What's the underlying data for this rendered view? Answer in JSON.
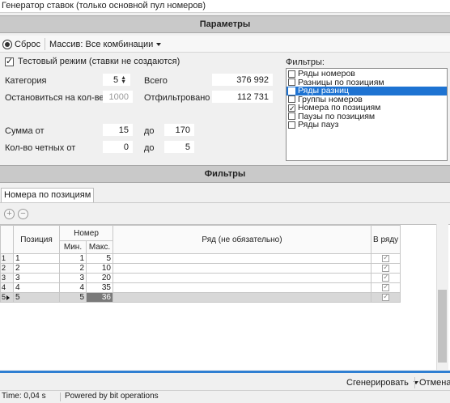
{
  "window": {
    "title": "Генератор ставок (только основной пул номеров)"
  },
  "params_header": "Параметры",
  "toolbar": {
    "reset_label": "Сброс",
    "massiv_label": "Массив: Все комбинации"
  },
  "test_mode": {
    "label": "Тестовый режим (ставки не создаются)",
    "checked": true
  },
  "fields": {
    "category_label": "Категория",
    "category_value": "5",
    "total_label": "Всего",
    "total_value": "376 992",
    "stop_label": "Остановиться на кол-ве",
    "stop_value": "1000",
    "filtered_label": "Отфильтровано",
    "filtered_value": "112 731",
    "sum_label": "Сумма от",
    "sum_from": "15",
    "sum_to_label": "до",
    "sum_to": "170",
    "even_label": "Кол-во четных от",
    "even_from": "0",
    "even_to_label": "до",
    "even_to": "5"
  },
  "filters": {
    "label": "Фильтры:",
    "items": [
      {
        "label": "Ряды номеров",
        "checked": false,
        "selected": false
      },
      {
        "label": "Разницы по позициям",
        "checked": false,
        "selected": false
      },
      {
        "label": "Ряды разниц",
        "checked": false,
        "selected": true
      },
      {
        "label": "Группы номеров",
        "checked": false,
        "selected": false
      },
      {
        "label": "Номера по позициям",
        "checked": true,
        "selected": false
      },
      {
        "label": "Паузы по позициям",
        "checked": false,
        "selected": false
      },
      {
        "label": "Ряды пауз",
        "checked": false,
        "selected": false
      }
    ]
  },
  "filters_header": "Фильтры",
  "tab": {
    "label": "Номера по позициям"
  },
  "grid": {
    "col_position": "Позиция",
    "col_number": "Номер",
    "col_min": "Мин.",
    "col_max": "Макс.",
    "col_row": "Ряд (не обязательно)",
    "col_inrow": "В ряду",
    "rows": [
      {
        "n": "1",
        "pos": "1",
        "min": "1",
        "max": "5"
      },
      {
        "n": "2",
        "pos": "2",
        "min": "2",
        "max": "10"
      },
      {
        "n": "3",
        "pos": "3",
        "min": "3",
        "max": "20"
      },
      {
        "n": "4",
        "pos": "4",
        "min": "4",
        "max": "35"
      },
      {
        "n": "5",
        "pos": "5",
        "min": "5",
        "max": "36"
      }
    ]
  },
  "actions": {
    "generate_label": "Сгенерировать",
    "cancel_label": "Отмена"
  },
  "status": {
    "time": "Time: 0,04 s",
    "powered": "Powered by bit operations"
  }
}
